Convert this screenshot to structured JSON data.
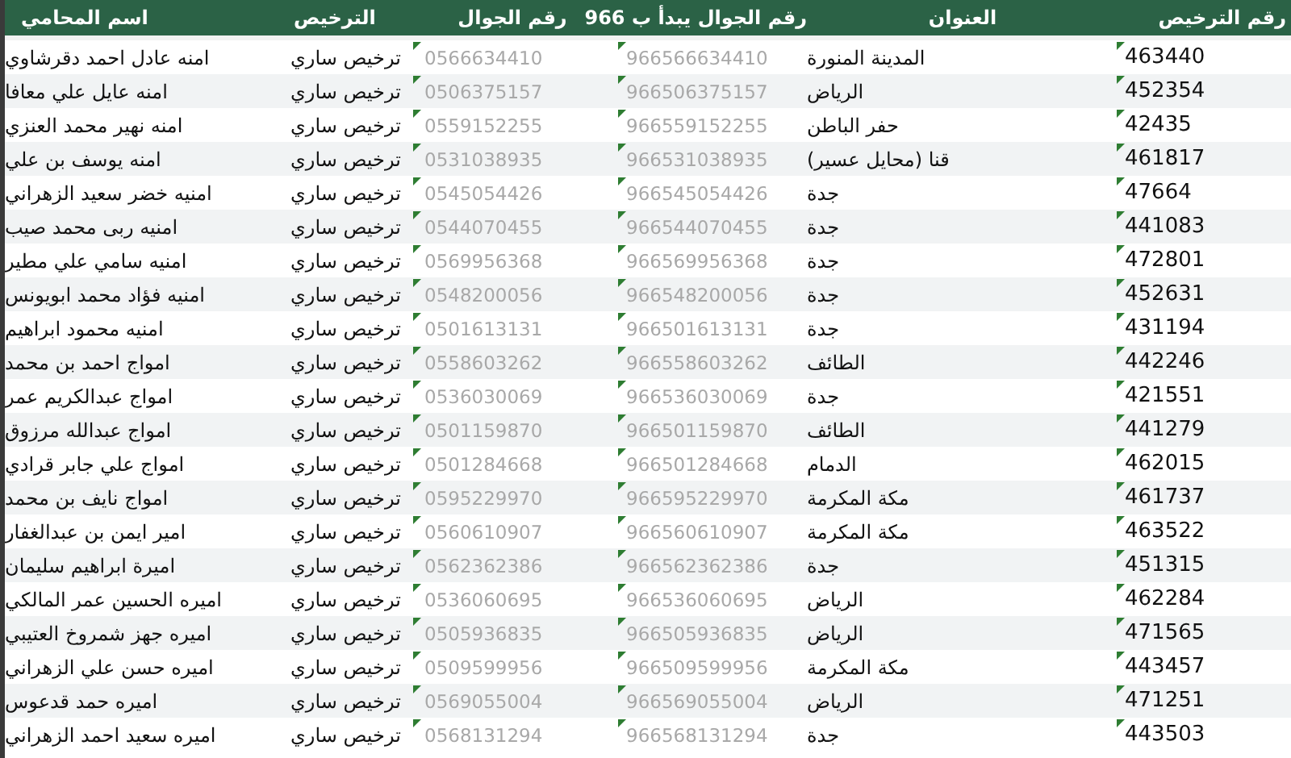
{
  "table": {
    "columns": [
      "رقم الترخيص",
      "العنوان",
      "رقم الجوال يبدأ ب 966",
      "رقم الجوال",
      "الترخيص",
      "اسم المحامي"
    ],
    "rows": [
      {
        "license_no": "463440",
        "address": "المدينة المنورة",
        "phone_intl": "966566634410",
        "phone": "0566634410",
        "license": "ترخيص ساري",
        "name": "امنه عادل احمد دقرشاوي"
      },
      {
        "license_no": "452354",
        "address": "الرياض",
        "phone_intl": "966506375157",
        "phone": "0506375157",
        "license": "ترخيص ساري",
        "name": "امنه عايل علي معافا"
      },
      {
        "license_no": "42435",
        "address": "حفر الباطن",
        "phone_intl": "966559152255",
        "phone": "0559152255",
        "license": "ترخيص ساري",
        "name": "امنه نهير محمد العنزي"
      },
      {
        "license_no": "461817",
        "address": "قنا (محايل عسير)",
        "phone_intl": "966531038935",
        "phone": "0531038935",
        "license": "ترخيص ساري",
        "name": "امنه يوسف بن علي"
      },
      {
        "license_no": "47664",
        "address": "جدة",
        "phone_intl": "966545054426",
        "phone": "0545054426",
        "license": "ترخيص ساري",
        "name": "امنيه خضر سعيد الزهراني"
      },
      {
        "license_no": "441083",
        "address": "جدة",
        "phone_intl": "966544070455",
        "phone": "0544070455",
        "license": "ترخيص ساري",
        "name": "امنيه ربى محمد صيب"
      },
      {
        "license_no": "472801",
        "address": "جدة",
        "phone_intl": "966569956368",
        "phone": "0569956368",
        "license": "ترخيص ساري",
        "name": "امنيه سامي علي مطير"
      },
      {
        "license_no": "452631",
        "address": "جدة",
        "phone_intl": "966548200056",
        "phone": "0548200056",
        "license": "ترخيص ساري",
        "name": "امنيه فؤاد محمد ابويونس"
      },
      {
        "license_no": "431194",
        "address": "جدة",
        "phone_intl": "966501613131",
        "phone": "0501613131",
        "license": "ترخيص ساري",
        "name": "امنيه محمود ابراهيم"
      },
      {
        "license_no": "442246",
        "address": "الطائف",
        "phone_intl": "966558603262",
        "phone": "0558603262",
        "license": "ترخيص ساري",
        "name": "امواج احمد بن محمد"
      },
      {
        "license_no": "421551",
        "address": "جدة",
        "phone_intl": "966536030069",
        "phone": "0536030069",
        "license": "ترخيص ساري",
        "name": "امواج عبدالكريم عمر"
      },
      {
        "license_no": "441279",
        "address": "الطائف",
        "phone_intl": "966501159870",
        "phone": "0501159870",
        "license": "ترخيص ساري",
        "name": "امواج عبدالله مرزوق"
      },
      {
        "license_no": "462015",
        "address": "الدمام",
        "phone_intl": "966501284668",
        "phone": "0501284668",
        "license": "ترخيص ساري",
        "name": "امواج علي جابر قرادي"
      },
      {
        "license_no": "461737",
        "address": "مكة المكرمة",
        "phone_intl": "966595229970",
        "phone": "0595229970",
        "license": "ترخيص ساري",
        "name": "امواج نايف بن محمد"
      },
      {
        "license_no": "463522",
        "address": "مكة المكرمة",
        "phone_intl": "966560610907",
        "phone": "0560610907",
        "license": "ترخيص ساري",
        "name": "امير ايمن بن عبدالغفار"
      },
      {
        "license_no": "451315",
        "address": "جدة",
        "phone_intl": "966562362386",
        "phone": "0562362386",
        "license": "ترخيص ساري",
        "name": "اميرة ابراهيم سليمان"
      },
      {
        "license_no": "462284",
        "address": "الرياض",
        "phone_intl": "966536060695",
        "phone": "0536060695",
        "license": "ترخيص ساري",
        "name": "اميره الحسين عمر المالكي"
      },
      {
        "license_no": "471565",
        "address": "الرياض",
        "phone_intl": "966505936835",
        "phone": "0505936835",
        "license": "ترخيص ساري",
        "name": "اميره جهز شمروخ العتيبي"
      },
      {
        "license_no": "443457",
        "address": "مكة المكرمة",
        "phone_intl": "966509599956",
        "phone": "0509599956",
        "license": "ترخيص ساري",
        "name": "اميره حسن علي الزهراني"
      },
      {
        "license_no": "471251",
        "address": "الرياض",
        "phone_intl": "966569055004",
        "phone": "0569055004",
        "license": "ترخيص ساري",
        "name": "اميره حمد قدعوس"
      },
      {
        "license_no": "443503",
        "address": "جدة",
        "phone_intl": "966568131294",
        "phone": "0568131294",
        "license": "ترخيص ساري",
        "name": "اميره سعيد احمد الزهراني"
      }
    ]
  }
}
